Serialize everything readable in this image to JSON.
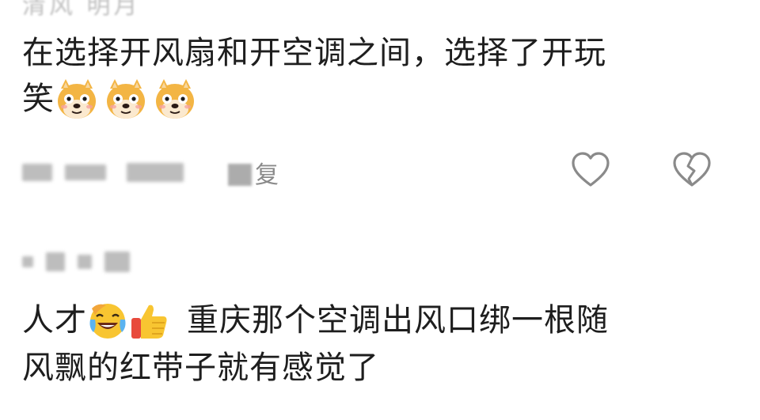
{
  "top_fragment": "清风 明月",
  "comments": [
    {
      "text_line1": "在选择开风扇和开空调之间，选择了开玩",
      "text_line2": "笑",
      "emojis": [
        "doge-emoji",
        "doge-emoji",
        "doge-emoji"
      ],
      "reply_label": "复"
    },
    {
      "text_before": "人才",
      "emojis": [
        "laugh-cry-emoji",
        "thumbs-up-emoji"
      ],
      "text_after": "重庆那个空调出风口绑一根随",
      "text_line2": "风飘的红带子就有感觉了"
    }
  ],
  "icons": {
    "like": "heart-outline-icon",
    "dislike": "broken-heart-icon"
  },
  "colors": {
    "text": "#1e1e1e",
    "meta": "#8a8a8a",
    "icon": "#8a8a8a"
  }
}
